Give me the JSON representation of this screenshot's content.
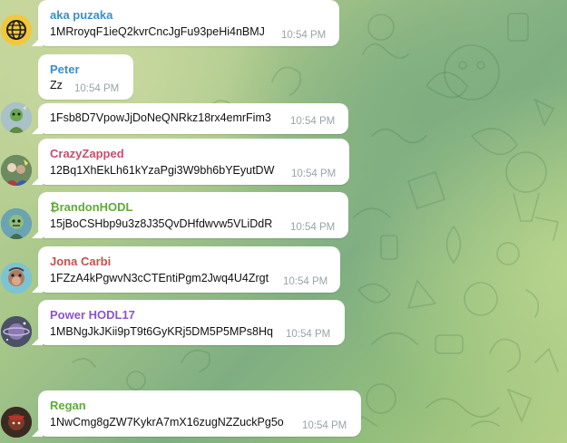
{
  "colors": {
    "sender_blue": "#3a8fc5",
    "sender_red": "#c94d6c",
    "sender_green": "#5faa3b",
    "sender_purple": "#8a55c8",
    "sender_brown": "#c4524f",
    "time_gray": "#9aa3a8"
  },
  "messages": [
    {
      "sender": "aka puzaka",
      "text": "1MRroyqF1ieQ2kvrCncJgFu93peHi4nBMJ",
      "time": "10:54 PM",
      "avatar": "globe-avatar"
    },
    {
      "sender": "Peter",
      "text": "Zz",
      "time": "10:54 PM",
      "avatar": ""
    },
    {
      "sender": "",
      "text": "1Fsb8D7VpowJjDoNeQNRkz18rx4emrFim3",
      "time": "10:54 PM",
      "avatar": "character-avatar"
    },
    {
      "sender": "CrazyZapped",
      "text": "12Bq1XhEkLh61kYzaPgi3W9bh6bYEyutDW",
      "time": "10:54 PM",
      "avatar": "photo-avatar"
    },
    {
      "sender": "₿randonHODL",
      "text": "15jBoCSHbp9u3z8J35QvDHfdwvw5VLiDdR",
      "time": "10:54 PM",
      "avatar": "zombie-avatar"
    },
    {
      "sender": "Jona Carbi",
      "text": "1FZzA4kPgwvN3cCTEntiPgm2Jwq4U4Zrgt",
      "time": "10:54 PM",
      "avatar": "ape-avatar"
    },
    {
      "sender": "Power HODL17",
      "text": "1MBNgJkJKii9pT9t6GyKRj5DM5P5MPs8Hq",
      "time": "10:54 PM",
      "avatar": "planet-avatar"
    },
    {
      "sender": "Regan",
      "text": "1NwCmg8gZW7KykrA7mX16zugNZZuckPg5o",
      "time": "10:54 PM",
      "avatar": "dark-avatar"
    }
  ]
}
